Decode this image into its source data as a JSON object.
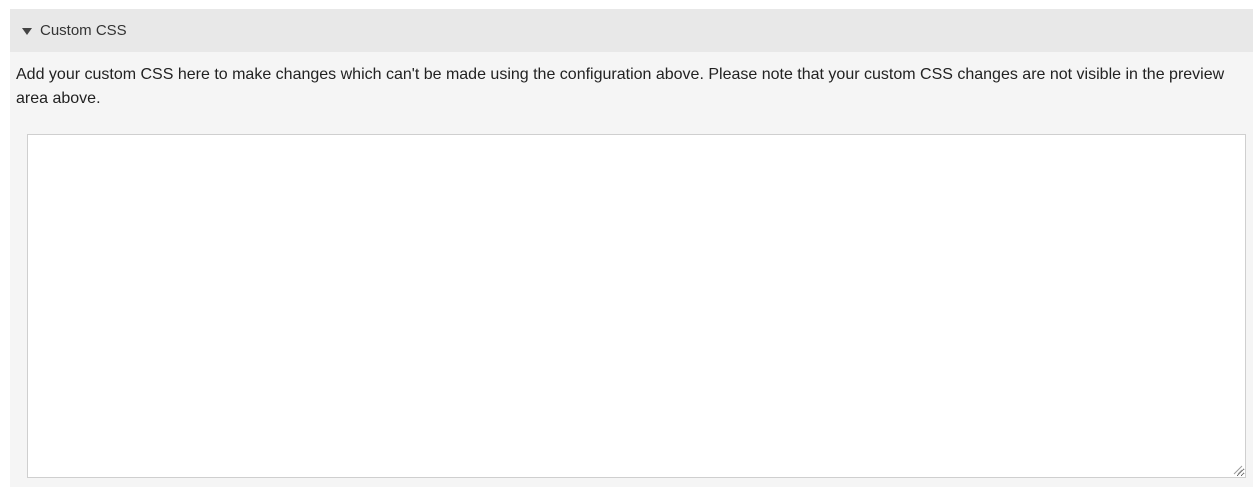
{
  "section": {
    "title": "Custom CSS",
    "expanded": true,
    "toggle_icon": "triangle-down-icon"
  },
  "description": "Add your custom CSS here to make changes which can't be made using the configuration above. Please note that your custom CSS changes are not visible in the preview area above.",
  "textarea": {
    "value": "",
    "placeholder": ""
  },
  "colors": {
    "header_background": "#e8e8e8",
    "panel_background": "#f5f5f5",
    "textarea_border": "#cfcfcf"
  }
}
